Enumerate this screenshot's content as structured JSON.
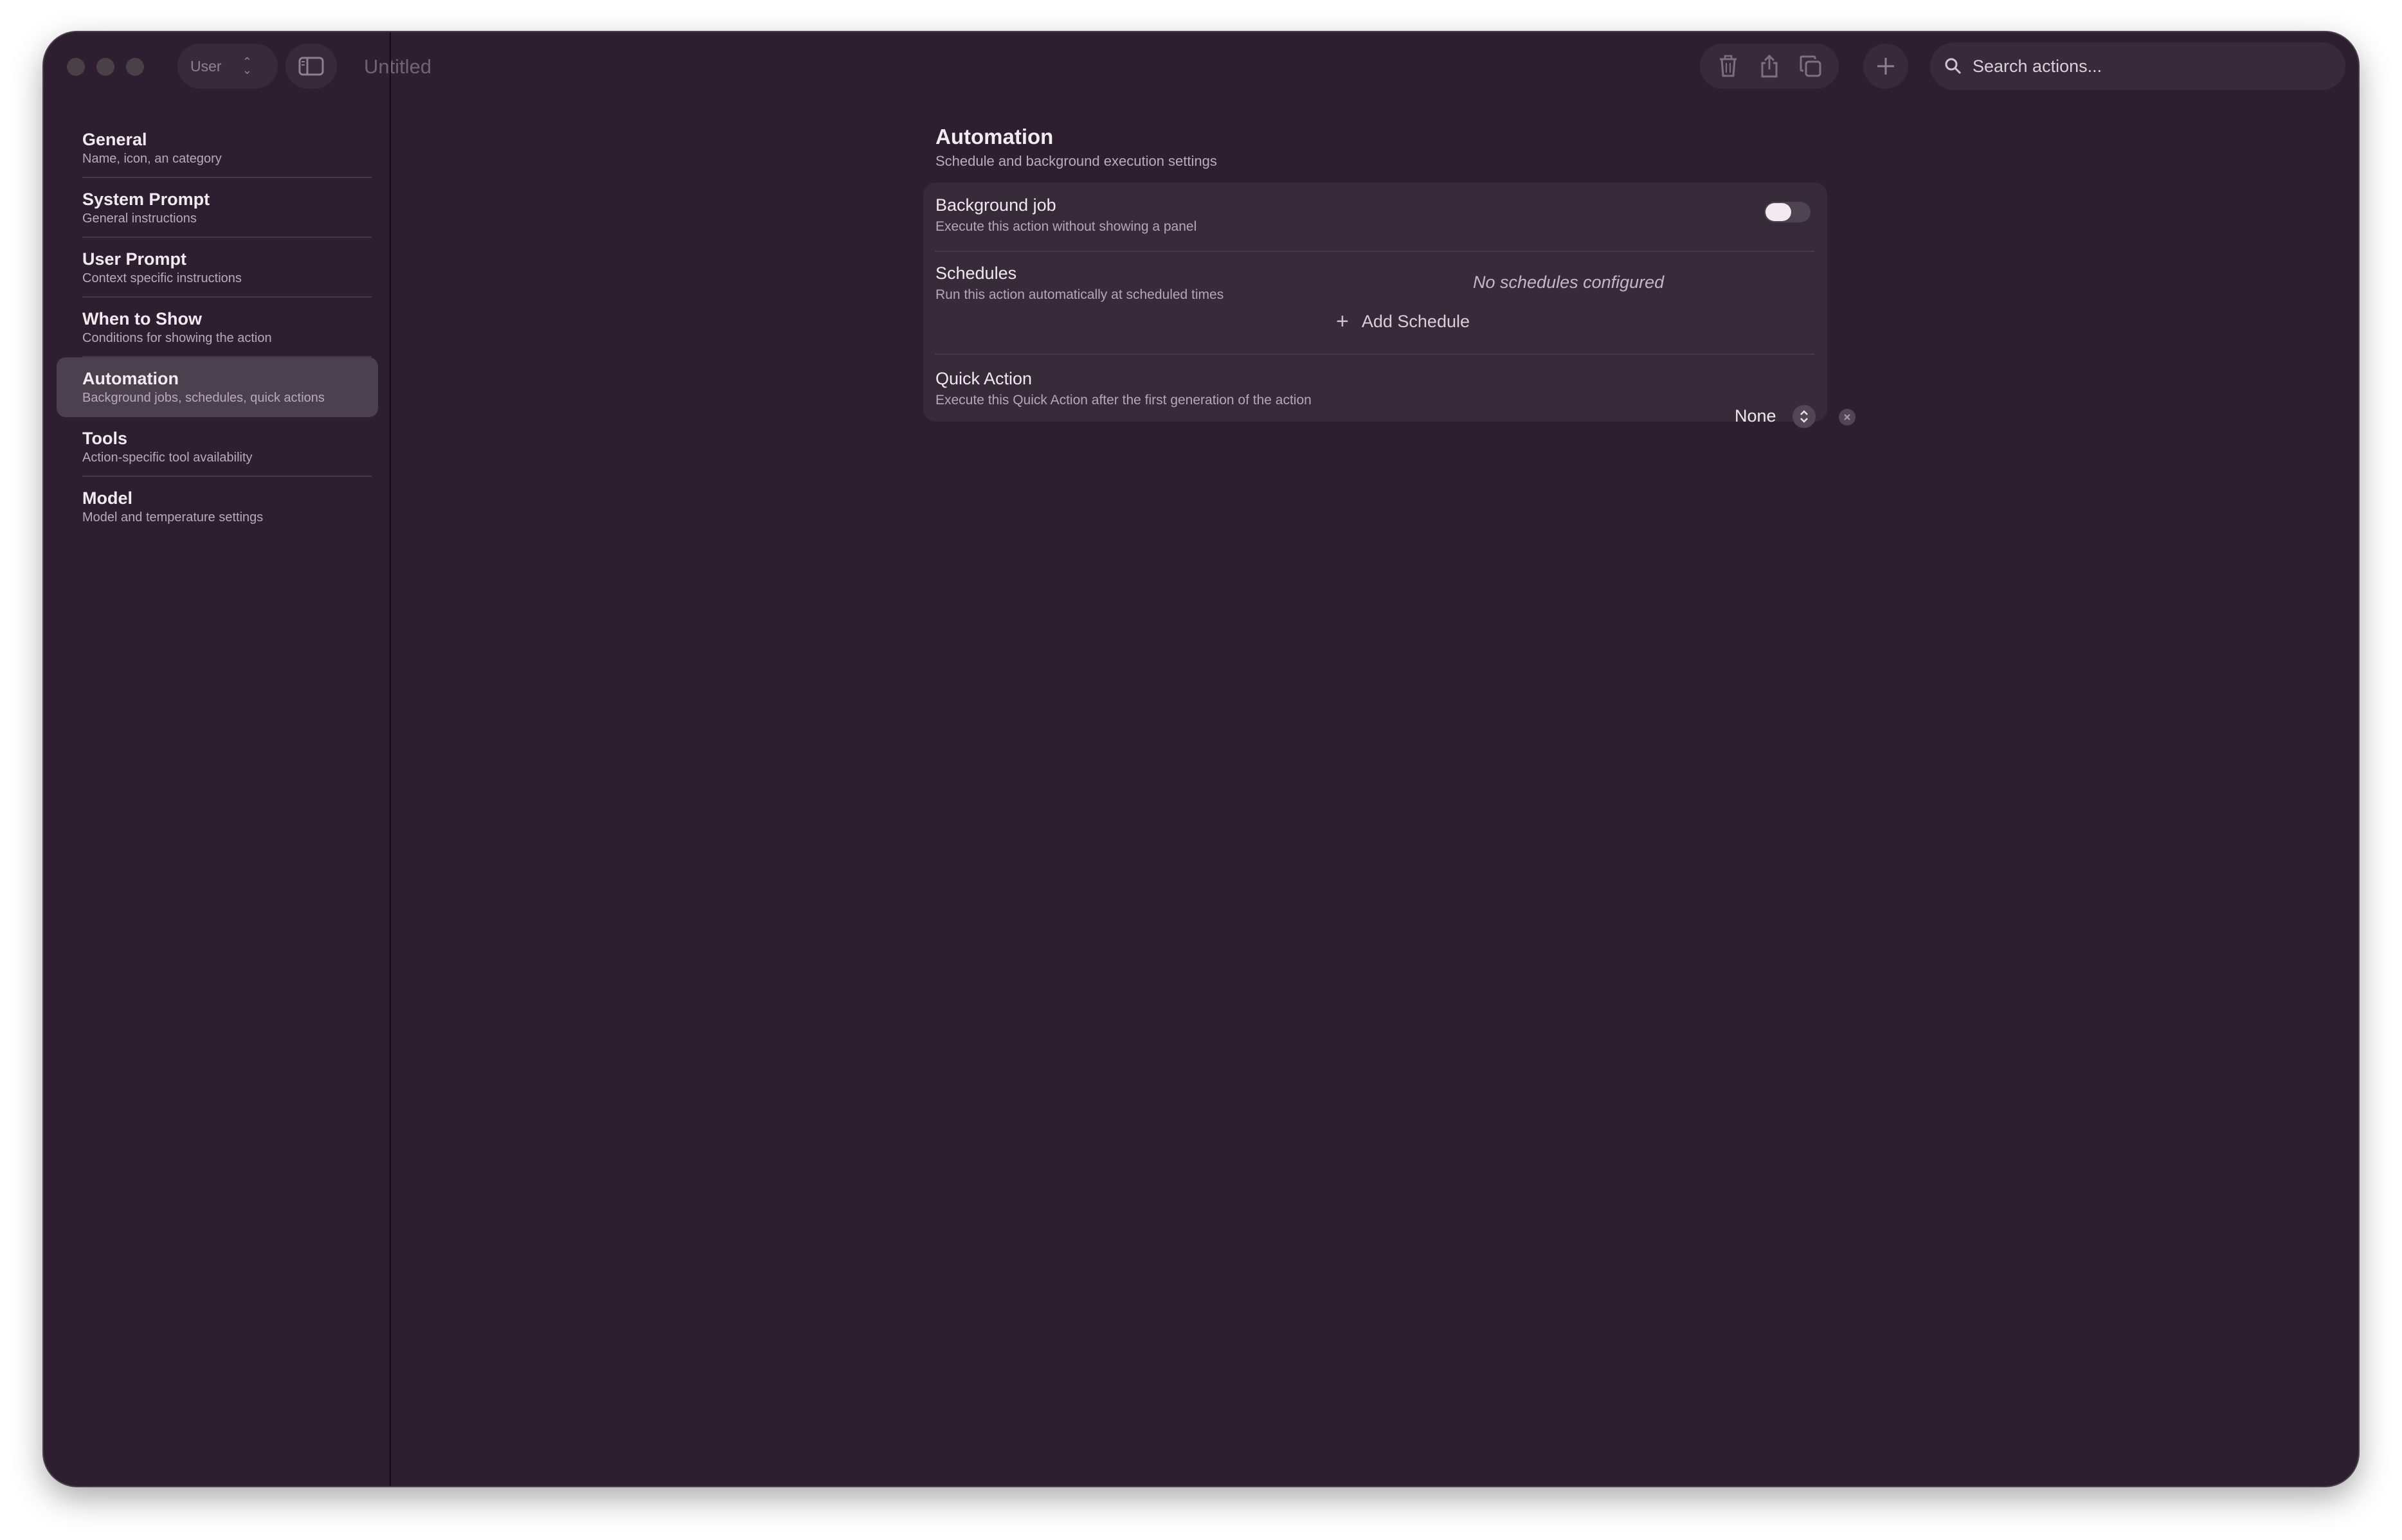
{
  "window": {
    "title": "Untitled",
    "user_selector": "User"
  },
  "search": {
    "placeholder": "Search actions..."
  },
  "sidebar": {
    "items": [
      {
        "title": "General",
        "subtitle": "Name, icon, an category"
      },
      {
        "title": "System Prompt",
        "subtitle": "General instructions"
      },
      {
        "title": "User Prompt",
        "subtitle": "Context specific instructions"
      },
      {
        "title": "When to Show",
        "subtitle": "Conditions for showing the action"
      },
      {
        "title": "Automation",
        "subtitle": "Background jobs, schedules, quick actions",
        "active": true
      },
      {
        "title": "Tools",
        "subtitle": "Action-specific tool availability"
      },
      {
        "title": "Model",
        "subtitle": "Model and temperature settings"
      }
    ]
  },
  "main": {
    "title": "Automation",
    "subtitle": "Schedule and background execution settings",
    "background_job": {
      "title": "Background job",
      "subtitle": "Execute this action without showing a panel",
      "enabled": false
    },
    "schedules": {
      "title": "Schedules",
      "subtitle": "Run this action automatically at scheduled times",
      "empty_text": "No schedules configured",
      "add_label": "Add Schedule"
    },
    "quick_action": {
      "title": "Quick Action",
      "subtitle": "Execute this Quick Action after the first generation of the action",
      "value": "None"
    }
  },
  "icons": {
    "toolbar": [
      "trash-icon",
      "share-icon",
      "duplicate-icon",
      "plus-icon",
      "search-icon",
      "sidebar-icon"
    ]
  },
  "colors": {
    "window_bg": "#2d1f2f",
    "card_bg": "#372a39",
    "active_item_bg": "#4b404d"
  }
}
